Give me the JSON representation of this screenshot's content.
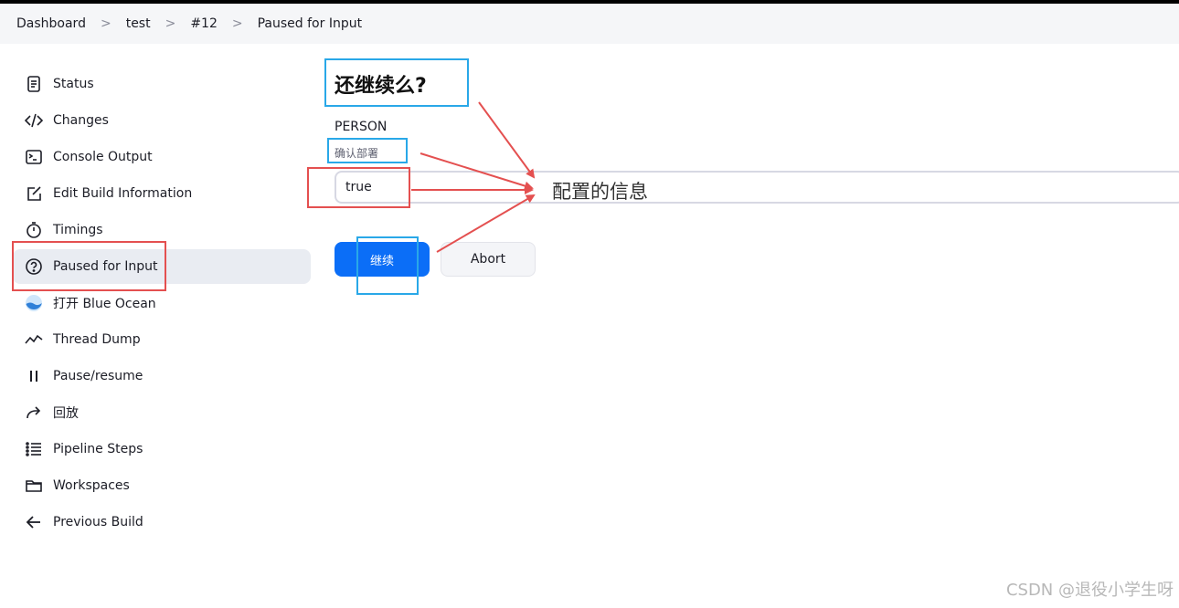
{
  "breadcrumb": {
    "items": [
      "Dashboard",
      "test",
      "#12",
      "Paused for Input"
    ],
    "separator": ">"
  },
  "sidebar": {
    "items": [
      {
        "label": "Status",
        "icon": "document-icon"
      },
      {
        "label": "Changes",
        "icon": "code-icon"
      },
      {
        "label": "Console Output",
        "icon": "terminal-icon"
      },
      {
        "label": "Edit Build Information",
        "icon": "edit-icon"
      },
      {
        "label": "Timings",
        "icon": "stopwatch-icon"
      },
      {
        "label": "Paused for Input",
        "icon": "help-circle-icon",
        "active": true
      },
      {
        "label": "打开 Blue Ocean",
        "icon": "blue-ocean-icon"
      },
      {
        "label": "Thread Dump",
        "icon": "activity-icon"
      },
      {
        "label": "Pause/resume",
        "icon": "pause-icon"
      },
      {
        "label": "回放",
        "icon": "replay-icon"
      },
      {
        "label": "Pipeline Steps",
        "icon": "list-icon"
      },
      {
        "label": "Workspaces",
        "icon": "folder-icon"
      },
      {
        "label": "Previous Build",
        "icon": "arrow-left-icon"
      }
    ]
  },
  "input_form": {
    "title": "还继续么?",
    "param_name": "PERSON",
    "param_description": "确认部署",
    "param_value": "true",
    "proceed_label": "继续",
    "abort_label": "Abort"
  },
  "annotation": {
    "text": "配置的信息"
  },
  "watermark": "CSDN @退役小学生呀",
  "colors": {
    "primary": "#0b6ef7",
    "annotation_blue": "#29a8e8",
    "annotation_red": "#e45050"
  }
}
